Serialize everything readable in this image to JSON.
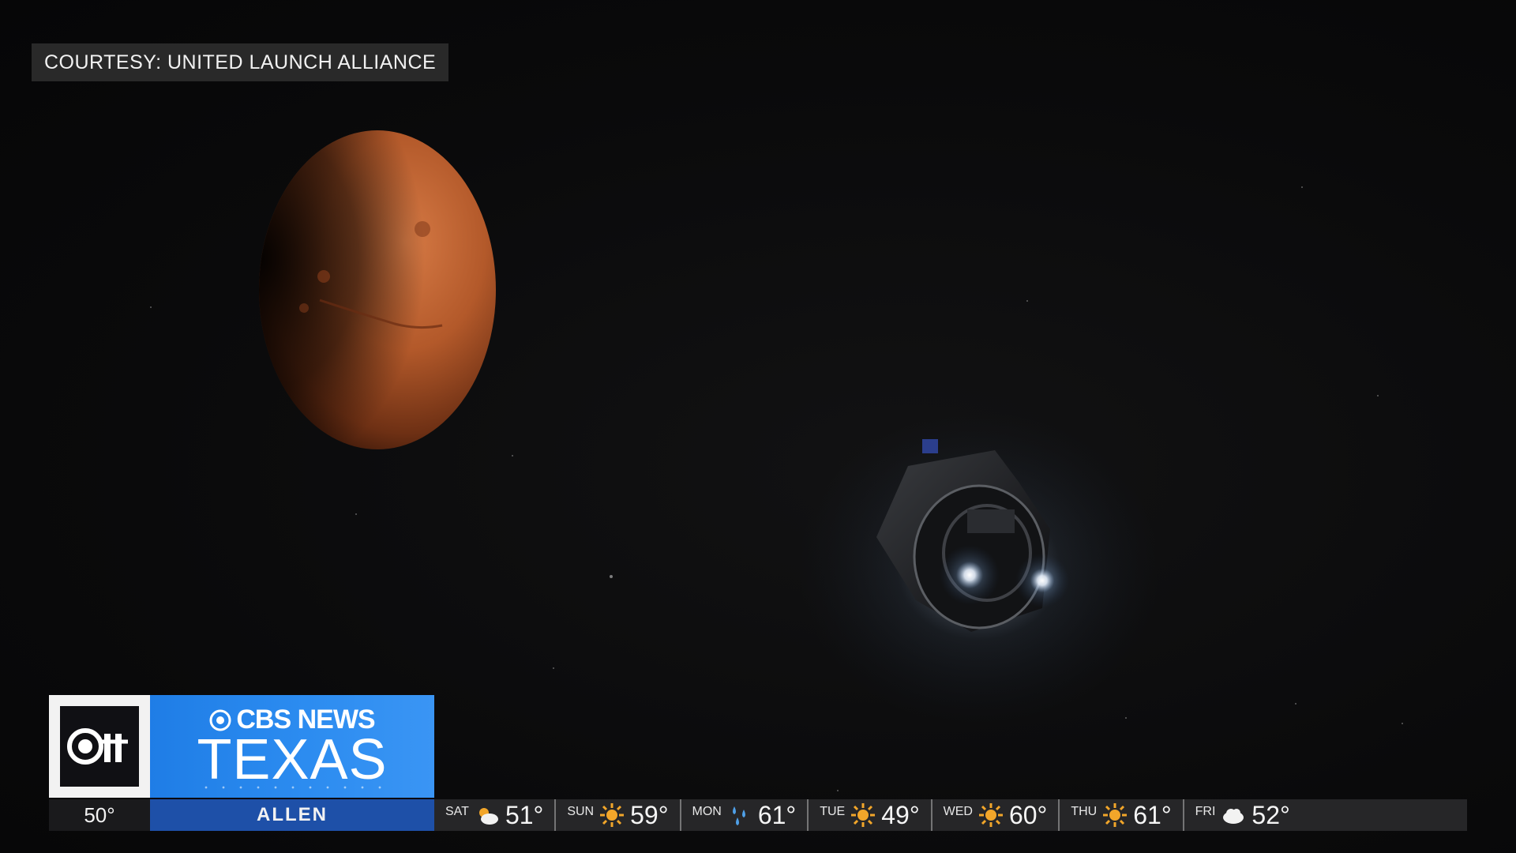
{
  "courtesy_label": "COURTESY: UNITED LAUNCH ALLIANCE",
  "logo": {
    "channel": "CBS 11"
  },
  "brand": {
    "top": "CBS NEWS",
    "bottom": "TEXAS"
  },
  "current": {
    "temp": "50°",
    "city": "ALLEN"
  },
  "forecast": [
    {
      "day": "SAT",
      "icon": "partly-cloudy-icon",
      "temp": "51°"
    },
    {
      "day": "SUN",
      "icon": "sun-icon",
      "temp": "59°"
    },
    {
      "day": "MON",
      "icon": "rain-icon",
      "temp": "61°"
    },
    {
      "day": "TUE",
      "icon": "sun-icon",
      "temp": "49°"
    },
    {
      "day": "WED",
      "icon": "sun-icon",
      "temp": "60°"
    },
    {
      "day": "THU",
      "icon": "sun-icon",
      "temp": "61°"
    },
    {
      "day": "FRI",
      "icon": "cloud-icon",
      "temp": "52°"
    }
  ],
  "colors": {
    "brand_blue": "#2c8cf0",
    "city_blue": "#1e50a8",
    "mars": "#c4622e",
    "sun": "#f2a62a"
  }
}
